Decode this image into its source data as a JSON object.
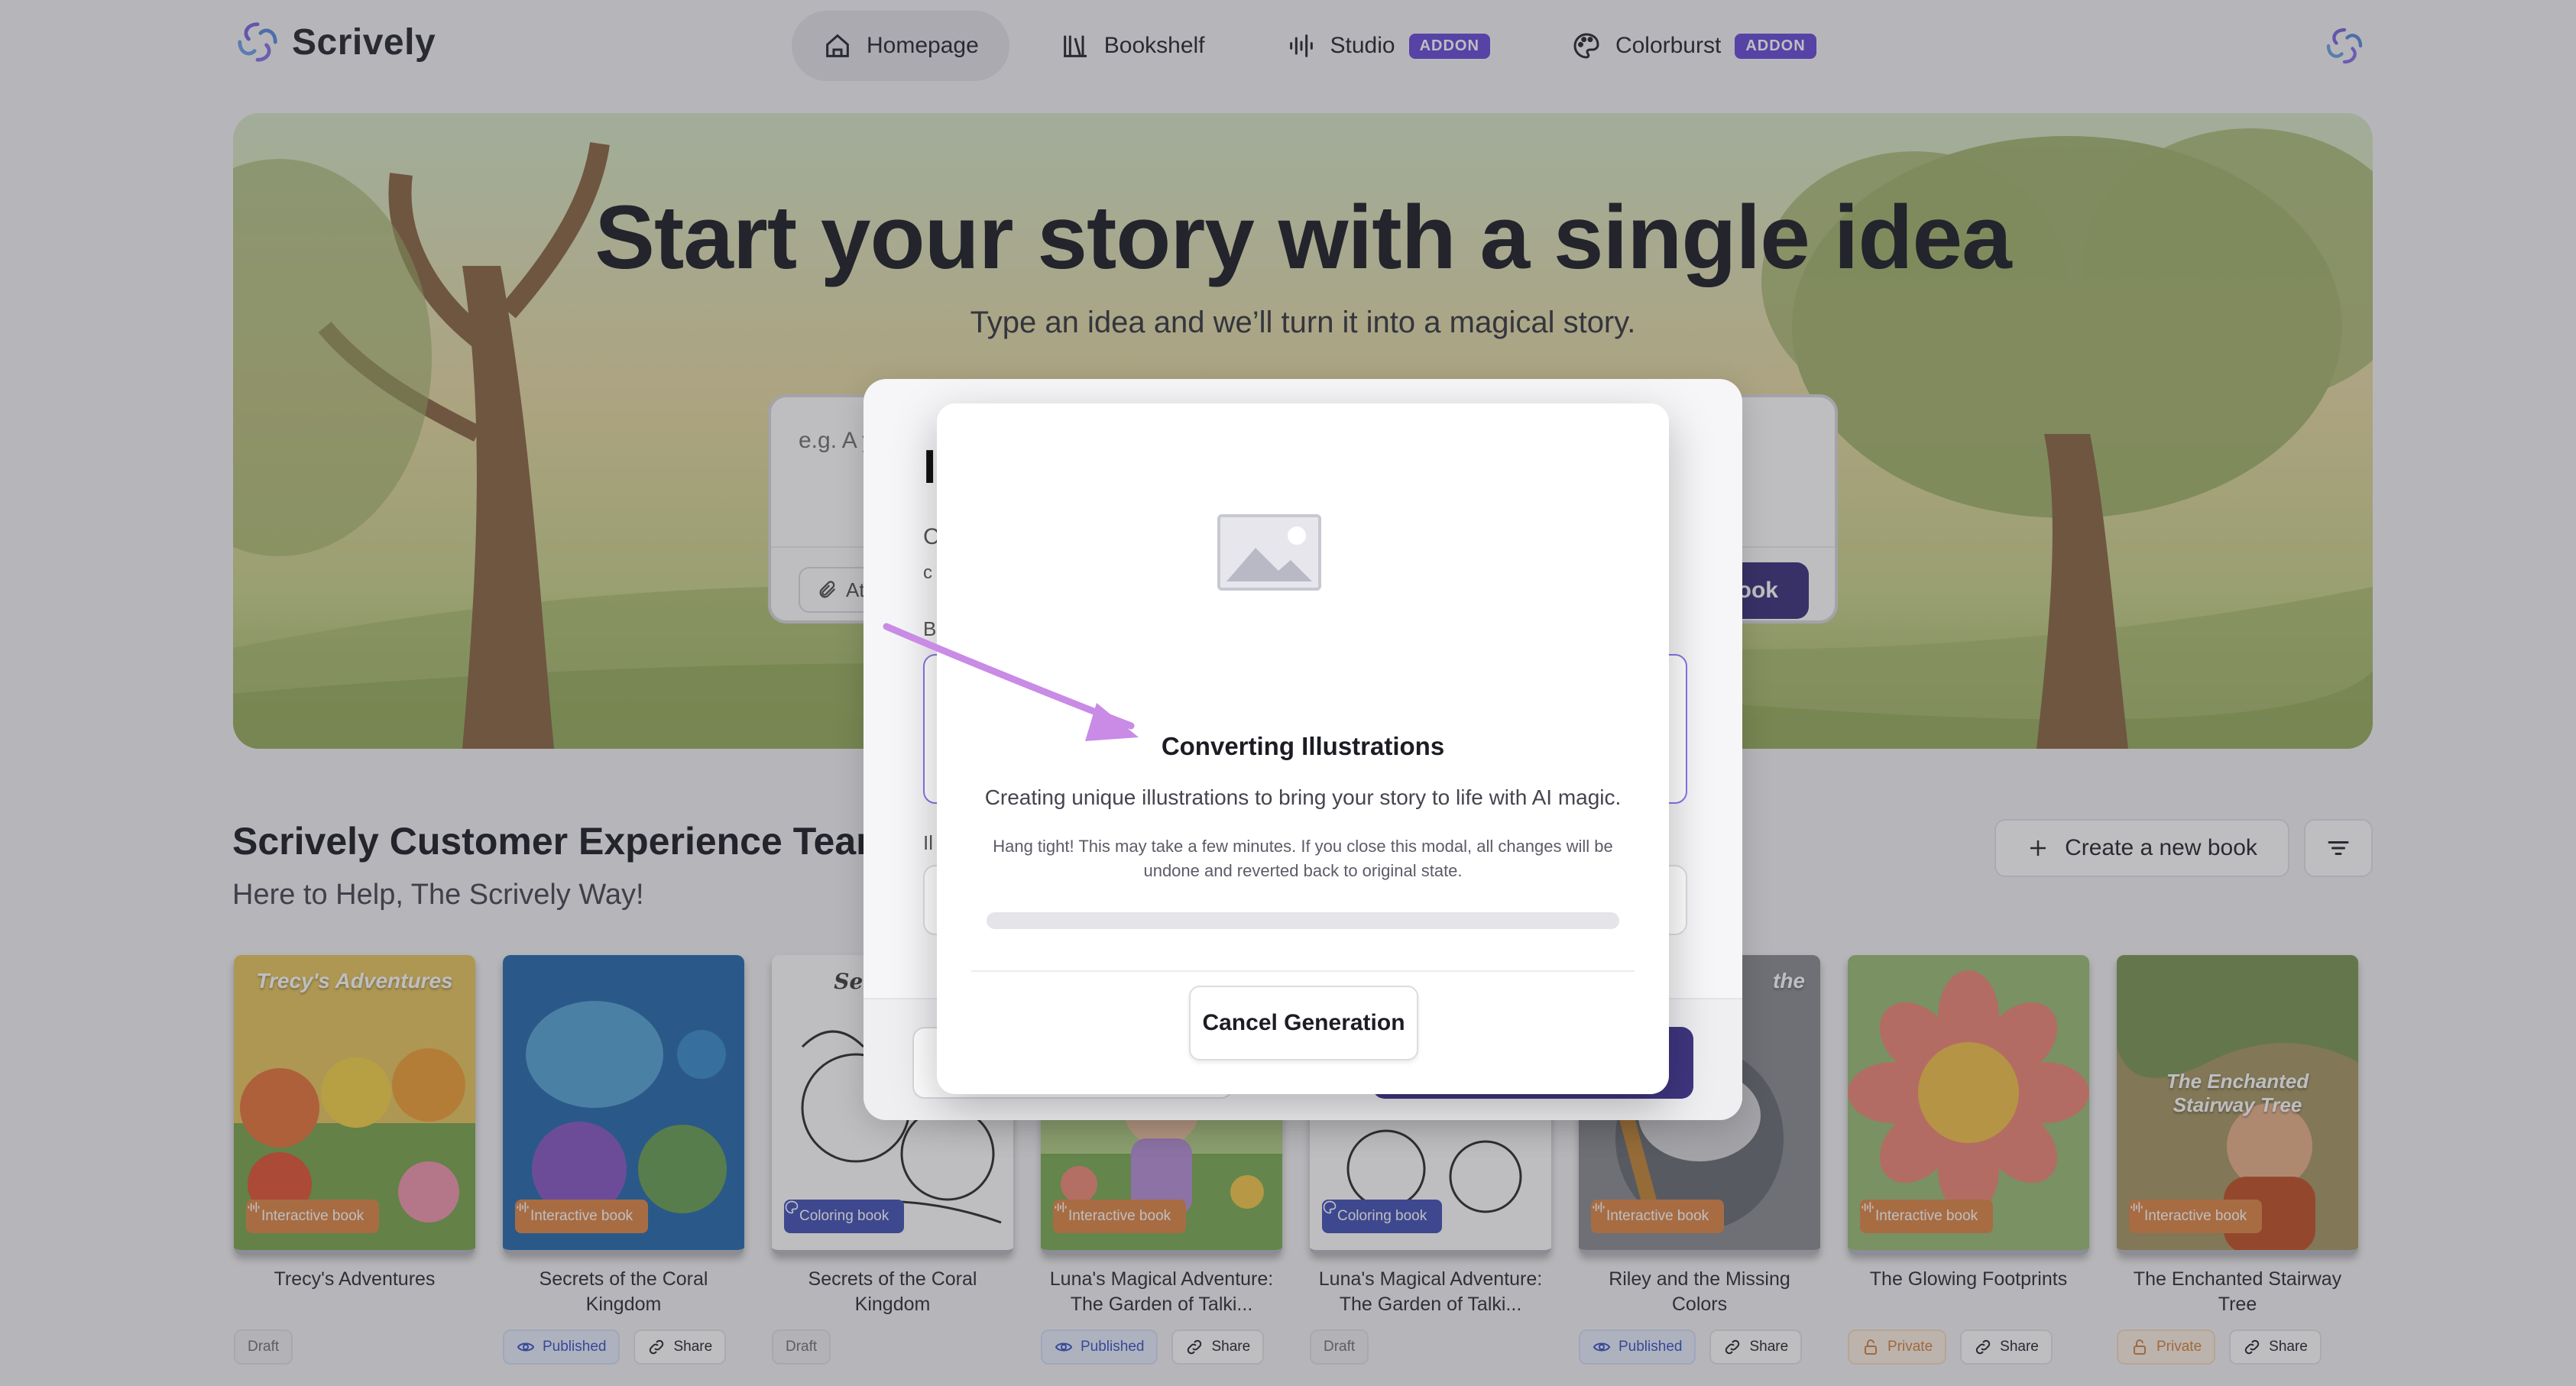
{
  "app": {
    "name": "Scrively"
  },
  "nav": {
    "tabs": [
      {
        "label": "Homepage",
        "active": true
      },
      {
        "label": "Bookshelf"
      },
      {
        "label": "Studio",
        "badge": "ADDON"
      },
      {
        "label": "Colorburst",
        "badge": "ADDON"
      }
    ]
  },
  "hero": {
    "title": "Start your story with a single idea",
    "subtitle": "Type an idea and we’ll turn it into a magical story.",
    "placeholder": "e.g. A y",
    "attach_label": "At",
    "create_label": "ook"
  },
  "team": {
    "title": "Scrively Customer Experience Team",
    "subtitle": "Here to Help, The Scrively Way!",
    "new_book_label": "Create a new book"
  },
  "books": [
    {
      "title": "Trecy's Adventures",
      "type": "Interactive book",
      "status": "Draft",
      "share": "",
      "cover_text": "Trecy's Adventures"
    },
    {
      "title": "Secrets of the Coral Kingdom",
      "type": "Interactive book",
      "status": "Published",
      "share": "Share"
    },
    {
      "title": "Secrets of the Coral Kingdom",
      "type": "Coloring book",
      "status": "Draft",
      "share": "",
      "cover_text": "Secr Cora"
    },
    {
      "title": "Luna's Magical Adventure: The Garden of Talki...",
      "type": "Interactive book",
      "status": "Published",
      "share": "Share"
    },
    {
      "title": "Luna's Magical Adventure: The Garden of Talki...",
      "type": "Coloring book",
      "status": "Draft",
      "share": ""
    },
    {
      "title": "Riley and the Missing Colors",
      "type": "Interactive book",
      "status": "Published",
      "share": "Share",
      "cover_text": "the"
    },
    {
      "title": "The Glowing Footprints",
      "type": "Interactive book",
      "status": "Private",
      "share": "Share"
    },
    {
      "title": "The Enchanted Stairway Tree",
      "type": "Interactive book",
      "status": "Private",
      "share": "Share",
      "cover_text": "The Enchanted Stairway Tree"
    }
  ],
  "underlying_dialog": {
    "heading_fragment": "I",
    "line1": "C",
    "line2": "c",
    "label_b": "B",
    "label_ii": "Il"
  },
  "modal": {
    "title": "Converting Illustrations",
    "subtitle": "Creating unique illustrations to bring your story to life with AI magic.",
    "note": "Hang tight! This may take a few minutes. If you close this modal, all changes will be undone and reverted back to original state.",
    "progress": 0,
    "cancel_label": "Cancel Generation"
  },
  "colors": {
    "accent": "#6b4fd8",
    "primary_dark": "#3f3680",
    "interactive_badge": "#e08a4c",
    "coloring_badge": "#4857b9"
  }
}
